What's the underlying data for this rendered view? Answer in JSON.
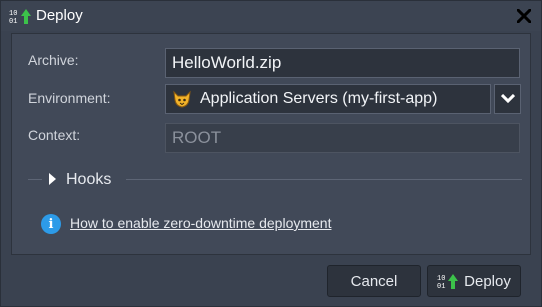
{
  "window": {
    "title": "Deploy",
    "title_icon": "binary-deploy-icon",
    "close_icon": "close-icon"
  },
  "form": {
    "archive_label": "Archive:",
    "archive_value": "HelloWorld.zip",
    "environment_label": "Environment:",
    "environment_value": "Application Servers (my-first-app)",
    "environment_icon": "tomcat-icon",
    "context_label": "Context:",
    "context_value": "ROOT"
  },
  "hooks": {
    "label": "Hooks",
    "expanded": false
  },
  "info": {
    "link_text": "How to enable zero-downtime deployment"
  },
  "buttons": {
    "cancel": "Cancel",
    "deploy": "Deploy"
  },
  "colors": {
    "background": "#3a4250",
    "panel": "#414958",
    "input_bg": "#2d333d",
    "deploy_arrow": "#3cc24a",
    "info_blue": "#2d9be8"
  }
}
